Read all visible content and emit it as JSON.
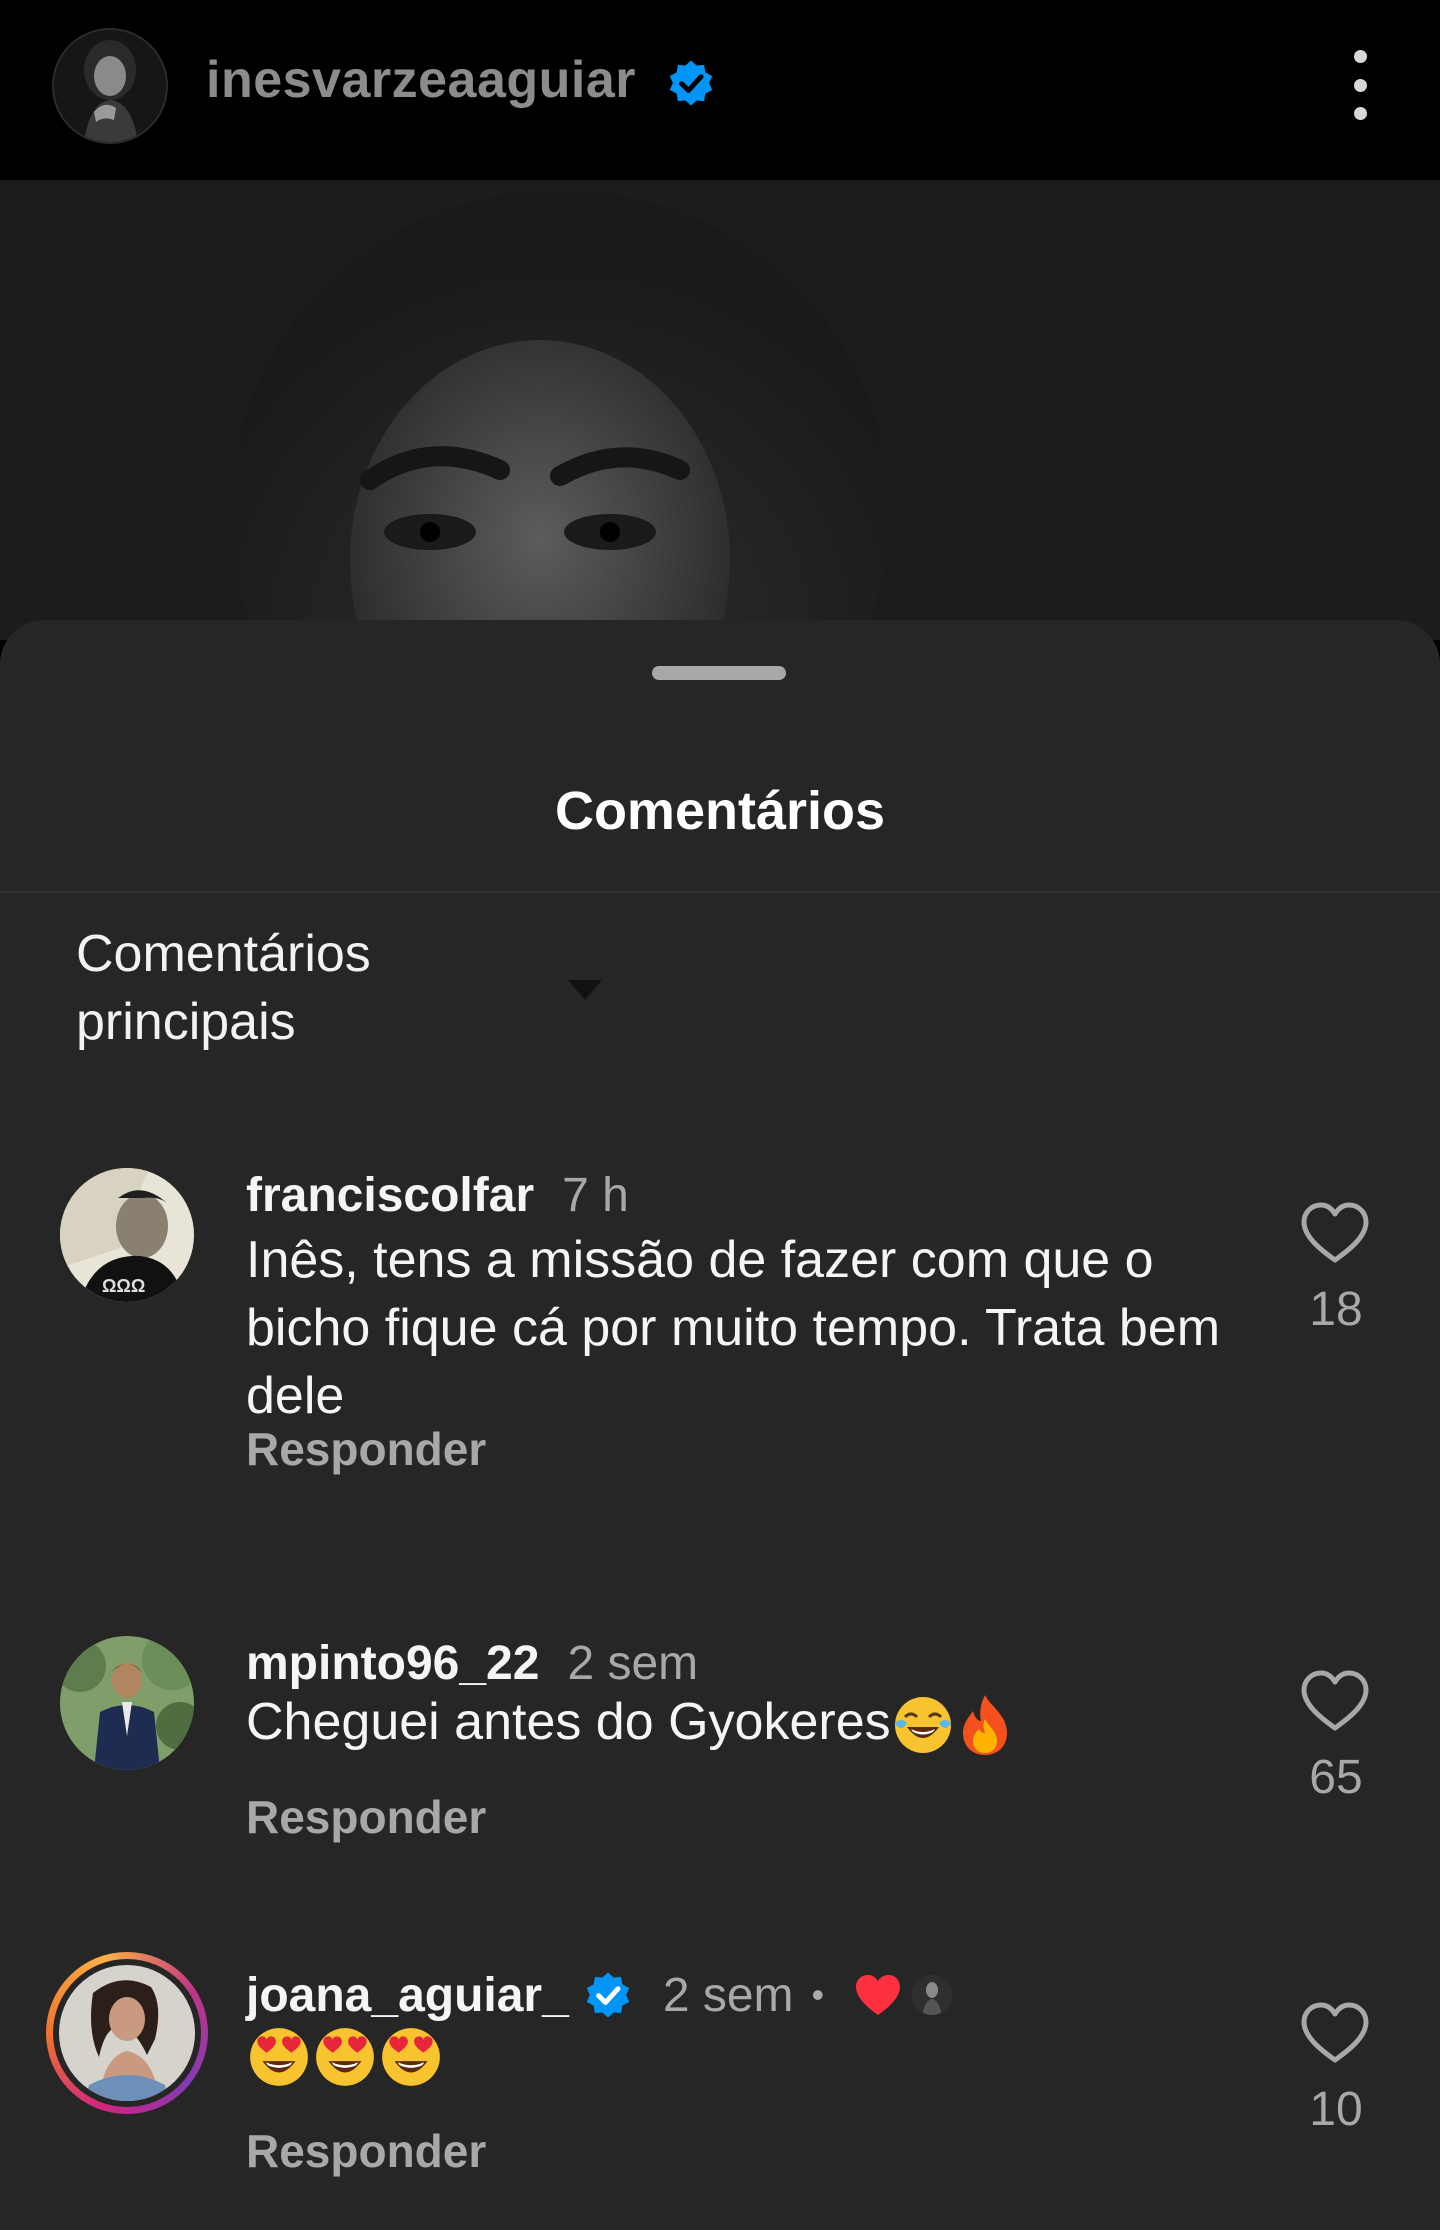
{
  "header": {
    "username": "inesvarzeaaguiar",
    "verified": true,
    "menu_icon": "more-vertical-icon"
  },
  "sheet": {
    "title": "Comentários",
    "sort_label": "Comentários principais",
    "sort_icon": "caret-down-icon"
  },
  "comments": [
    {
      "username": "franciscolfar",
      "time": "7 h",
      "text": "Inês, tens a missão de fazer com que o bicho fique cá por muito tempo. Trata bem dele",
      "reply_label": "Responder",
      "likes": "18"
    },
    {
      "username": "mpinto96_22",
      "time": "2 sem",
      "text": "Cheguei antes do Gyokeres",
      "emojis": [
        "face-with-tears-of-joy",
        "fire"
      ],
      "reply_label": "Responder",
      "likes": "65"
    },
    {
      "username": "joana_aguiar_",
      "verified": true,
      "time": "2 sem",
      "separator": "•",
      "creator_liked": true,
      "emojis": [
        "smiling-face-with-heart-eyes",
        "smiling-face-with-heart-eyes",
        "smiling-face-with-heart-eyes"
      ],
      "reply_label": "Responder",
      "likes": "10"
    }
  ],
  "colors": {
    "background": "#000000",
    "sheet": "#262626",
    "text_primary": "#f5f5f5",
    "text_secondary": "#a8a8a8",
    "verified_blue": "#0095f6",
    "like_red": "#ff3040"
  }
}
